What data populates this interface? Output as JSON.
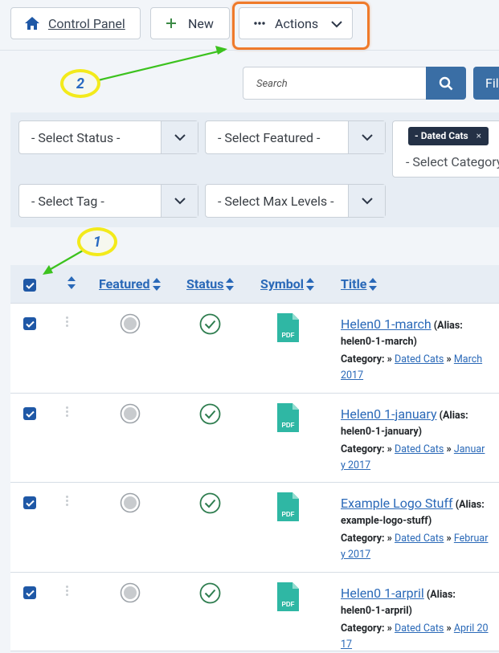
{
  "toolbar": {
    "control_panel": "Control Panel",
    "new": "New",
    "actions": "Actions",
    "filter_partial": "Fil"
  },
  "search": {
    "placeholder": "Search"
  },
  "filters": {
    "status": "- Select Status -",
    "featured": "- Select Featured -",
    "category_chip": "- Dated Cats",
    "chip_close": "×",
    "category": "- Select Category",
    "tag": "- Select Tag -",
    "max_levels": "- Select Max Levels -"
  },
  "table": {
    "headers": {
      "featured": "Featured",
      "status": "Status",
      "symbol": "Symbol",
      "title": "Title"
    },
    "pdf_label": "PDF",
    "rows": [
      {
        "title": "Helen0 1-march",
        "alias": "(Alias: helen0-1-march)",
        "category_label": "Category:",
        "sep": "»",
        "parent": "Dated Cats",
        "child": "March 2017"
      },
      {
        "title": "Helen0 1-january",
        "alias": "(Alias: helen0-1-january)",
        "category_label": "Category:",
        "sep": "»",
        "parent": "Dated Cats",
        "child": "January 2017"
      },
      {
        "title": "Example Logo Stuff",
        "alias": "(Alias: example-logo-stuff)",
        "category_label": "Category:",
        "sep": "»",
        "parent": "Dated Cats",
        "child": "February 2017"
      },
      {
        "title": "Helen0 1-arpril",
        "alias": "(Alias: helen0-1-arpril)",
        "category_label": "Category:",
        "sep": "»",
        "parent": "Dated Cats",
        "child": "April 2017"
      }
    ]
  },
  "callouts": {
    "one": "1",
    "two": "2"
  },
  "colors": {
    "primary": "#3a6ea5",
    "link": "#2a69b8",
    "highlight": "#ef7a2a",
    "callout": "#f3ea1b",
    "arrow": "#3cc21e",
    "pdf": "#2fb7a4",
    "status_ok": "#2e7d4f"
  }
}
